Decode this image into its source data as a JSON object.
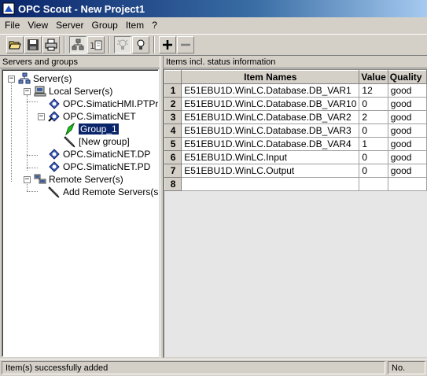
{
  "window": {
    "title": "OPC Scout - New Project1"
  },
  "menu": [
    "File",
    "View",
    "Server",
    "Group",
    "Item",
    "?"
  ],
  "toolbar": {
    "buttons": [
      "open-folder-icon",
      "save-icon",
      "print-icon",
      "network-servers-icon",
      "add-items-icon",
      "lightbulb-off-icon",
      "lightbulb-icon",
      "plus-icon",
      "minus-icon"
    ]
  },
  "left_panel": {
    "header": "Servers and groups"
  },
  "right_panel": {
    "header": "Items incl. status information"
  },
  "tree": {
    "root": "Server(s)",
    "local": "Local Server(s)",
    "hmi": "OPC.SimaticHMI.PTPro",
    "net": "OPC.SimaticNET",
    "group1": "Group_1",
    "newgroup": "[New group]",
    "netdp": "OPC.SimaticNET.DP",
    "netpd": "OPC.SimaticNET.PD",
    "remote": "Remote Server(s)",
    "addremote": "Add Remote Servers(s)"
  },
  "grid": {
    "columns": [
      "Item Names",
      "Value",
      "Quality"
    ],
    "rows": [
      {
        "num": "1",
        "name": "E51EBU1D.WinLC.Database.DB_VAR1",
        "value": "12",
        "quality": "good"
      },
      {
        "num": "2",
        "name": "E51EBU1D.WinLC.Database.DB_VAR10",
        "value": "0",
        "quality": "good"
      },
      {
        "num": "3",
        "name": "E51EBU1D.WinLC.Database.DB_VAR2",
        "value": "2",
        "quality": "good"
      },
      {
        "num": "4",
        "name": "E51EBU1D.WinLC.Database.DB_VAR3",
        "value": "0",
        "quality": "good"
      },
      {
        "num": "5",
        "name": "E51EBU1D.WinLC.Database.DB_VAR4",
        "value": "1",
        "quality": "good"
      },
      {
        "num": "6",
        "name": "E51EBU1D.WinLC.Input",
        "value": "0",
        "quality": "good"
      },
      {
        "num": "7",
        "name": "E51EBU1D.WinLC.Output",
        "value": "0",
        "quality": "good"
      },
      {
        "num": "8",
        "name": "",
        "value": "",
        "quality": ""
      }
    ]
  },
  "status": {
    "message": "Item(s) successfully added",
    "right": "No."
  }
}
